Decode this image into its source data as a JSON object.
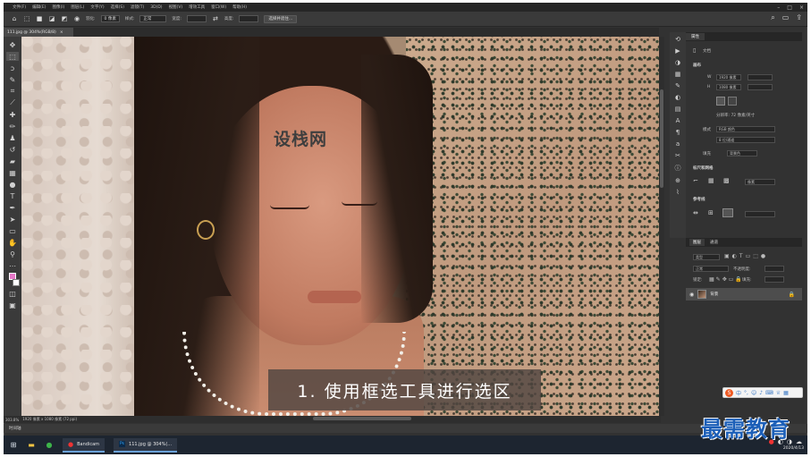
{
  "menu": [
    "文件(F)",
    "编辑(E)",
    "图像(I)",
    "图层(L)",
    "文字(Y)",
    "选择(S)",
    "滤镜(T)",
    "3D(D)",
    "视图(V)",
    "增效工具",
    "窗口(W)",
    "帮助(H)"
  ],
  "options": {
    "feather_label": "羽化:",
    "feather_value": "0 像素",
    "style_label": "样式:",
    "style_value": "正常",
    "width_label": "宽度:",
    "height_label": "高度:",
    "select_mask_button": "选择并遮住..."
  },
  "document": {
    "tab": "111.jpg @ 304%(RGB/8)",
    "watermark": "设栈网",
    "subtitle": "1. 使用框选工具进行选区"
  },
  "status": {
    "zoom": "303.8%",
    "size": "1920 像素 x 1080 像素 (72 ppi)"
  },
  "timeline_label": "时间轴",
  "properties": {
    "tab": "属性",
    "doc_label": "文档",
    "canvas_section": "画布",
    "width_field": "1920 像素",
    "height_field": "1080 像素",
    "resolution": "分辨率: 72 像素/英寸",
    "mode_label": "模式",
    "mode_value": "RGB 颜色",
    "depth_value": "8 位/通道",
    "fill_label": "填充",
    "fill_value": "背景色",
    "rulers_section": "标尺和网格",
    "unit_value": "像素",
    "guides_section": "参考线"
  },
  "layers": {
    "tabs": [
      "图层",
      "通道"
    ],
    "active_tab": "图层",
    "kind_label": "类型",
    "blend_label": "正常",
    "opacity_label": "不透明度:",
    "lock_label": "锁定:",
    "fill_label": "填充:",
    "layer_name": "背景"
  },
  "taskbar": {
    "apps": [
      "Bandicam",
      "111.jpg @ 304%(..."
    ],
    "clock": "2020/4/13"
  },
  "brand": "最需教育",
  "colors": {
    "foreground": "#e778c9",
    "background": "#ffffff",
    "ui_dark": "#323232",
    "brand": "#1c5fb8"
  }
}
